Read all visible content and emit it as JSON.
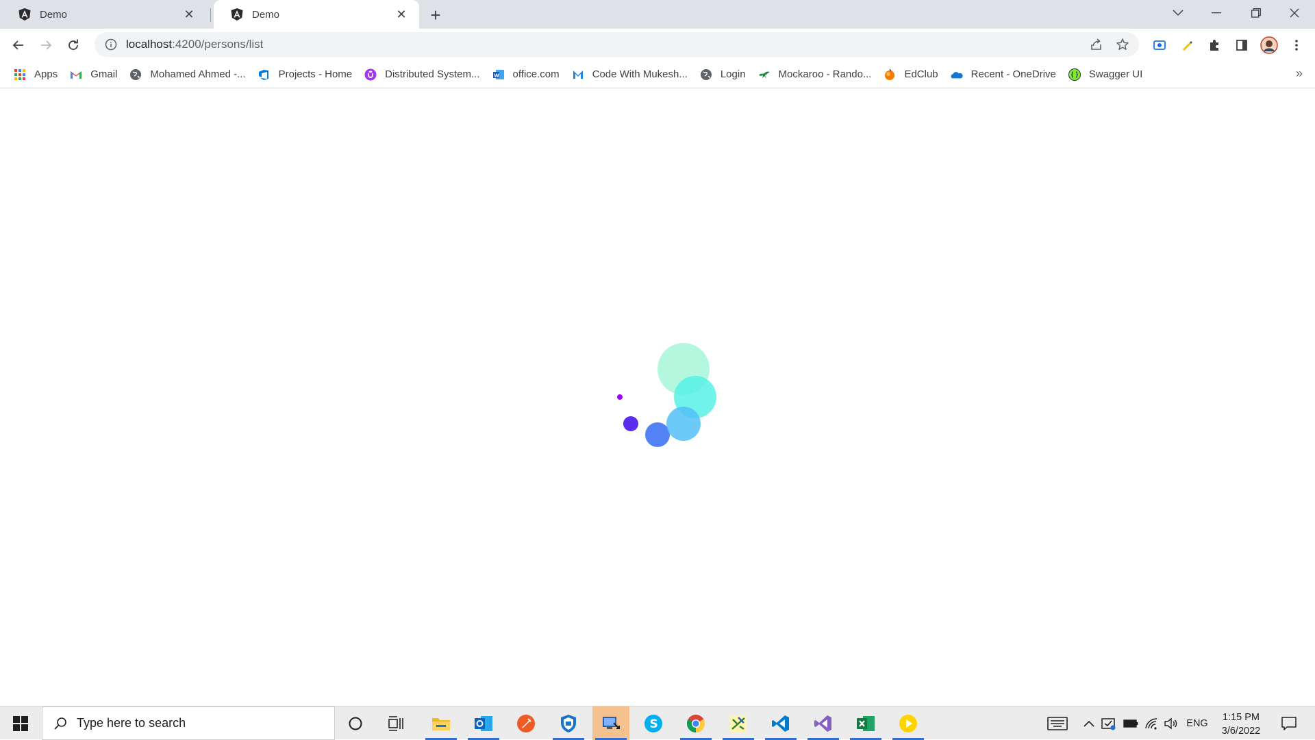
{
  "browser": {
    "tabs": [
      {
        "title": "Demo",
        "active": false
      },
      {
        "title": "Demo",
        "active": true
      }
    ],
    "address": {
      "host": "localhost",
      "path": ":4200/persons/list"
    },
    "bookmarks": [
      {
        "label": "Apps",
        "icon": "apps-grid-icon"
      },
      {
        "label": "Gmail",
        "icon": "gmail-icon"
      },
      {
        "label": "Mohamed Ahmed -...",
        "icon": "globe-icon"
      },
      {
        "label": "Projects - Home",
        "icon": "azure-devops-icon"
      },
      {
        "label": "Distributed System...",
        "icon": "udemy-icon"
      },
      {
        "label": "office.com",
        "icon": "word-icon"
      },
      {
        "label": "Code With Mukesh...",
        "icon": "mukesh-icon"
      },
      {
        "label": "Login",
        "icon": "globe-icon"
      },
      {
        "label": "Mockaroo - Rando...",
        "icon": "mockaroo-icon"
      },
      {
        "label": "EdClub",
        "icon": "edclub-icon"
      },
      {
        "label": "Recent - OneDrive",
        "icon": "onedrive-icon"
      },
      {
        "label": "Swagger UI",
        "icon": "swagger-icon"
      }
    ],
    "bookmarks_overflow": "»"
  },
  "content": {
    "state": "loading",
    "loader_colors": [
      "#9d00ff",
      "#5b2bf0",
      "#4a7af5",
      "#5ec6f8",
      "#5ef0e6",
      "#aef7dc"
    ]
  },
  "taskbar": {
    "search_placeholder": "Type here to search",
    "apps": [
      "cortana-icon",
      "task-view-icon",
      "file-explorer-icon",
      "outlook-icon",
      "postman-icon",
      "defender-icon",
      "remote-desktop-icon",
      "skype-icon",
      "chrome-icon",
      "network-tool-icon",
      "vscode-icon",
      "visual-studio-icon",
      "excel-icon",
      "media-player-icon"
    ],
    "language": "ENG",
    "time": "1:15 PM",
    "date": "3/6/2022"
  }
}
